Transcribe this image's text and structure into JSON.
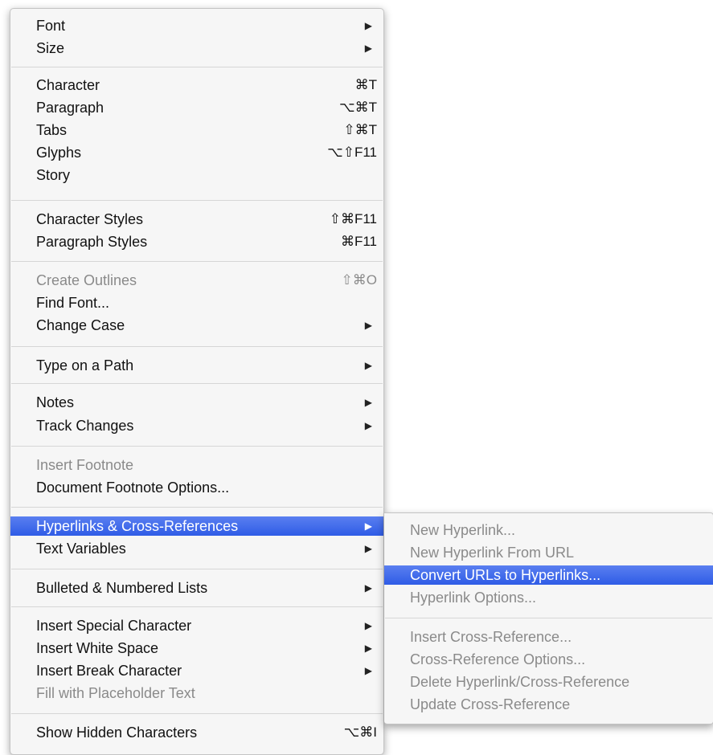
{
  "menu": {
    "items": [
      {
        "label": "Font"
      },
      {
        "label": "Size"
      },
      {
        "label": "Character",
        "shortcut": "⌘T"
      },
      {
        "label": "Paragraph",
        "shortcut": "⌥⌘T"
      },
      {
        "label": "Tabs",
        "shortcut": "⇧⌘T"
      },
      {
        "label": "Glyphs",
        "shortcut": "⌥⇧F11"
      },
      {
        "label": "Story"
      },
      {
        "label": "Character Styles",
        "shortcut": "⇧⌘F11"
      },
      {
        "label": "Paragraph Styles",
        "shortcut": "⌘F11"
      },
      {
        "label": "Create Outlines",
        "shortcut": "⇧⌘O"
      },
      {
        "label": "Find Font..."
      },
      {
        "label": "Change Case"
      },
      {
        "label": "Type on a Path"
      },
      {
        "label": "Notes"
      },
      {
        "label": "Track Changes"
      },
      {
        "label": "Insert Footnote"
      },
      {
        "label": "Document Footnote Options..."
      },
      {
        "label": "Hyperlinks & Cross-References"
      },
      {
        "label": "Text Variables"
      },
      {
        "label": "Bulleted & Numbered Lists"
      },
      {
        "label": "Insert Special Character"
      },
      {
        "label": "Insert White Space"
      },
      {
        "label": "Insert Break Character"
      },
      {
        "label": "Fill with Placeholder Text"
      },
      {
        "label": "Show Hidden Characters",
        "shortcut": "⌥⌘I"
      }
    ],
    "submenu_arrow": "▶"
  },
  "submenu": {
    "items": [
      {
        "label": "New Hyperlink..."
      },
      {
        "label": "New Hyperlink From URL"
      },
      {
        "label": "Convert URLs to Hyperlinks..."
      },
      {
        "label": "Hyperlink Options..."
      },
      {
        "label": "Insert Cross-Reference..."
      },
      {
        "label": "Cross-Reference Options..."
      },
      {
        "label": "Delete Hyperlink/Cross-Reference"
      },
      {
        "label": "Update Cross-Reference"
      }
    ]
  },
  "colors": {
    "highlight": "#3a64ea",
    "disabled_text": "#8a8a8a",
    "menu_background": "#f6f6f6"
  }
}
